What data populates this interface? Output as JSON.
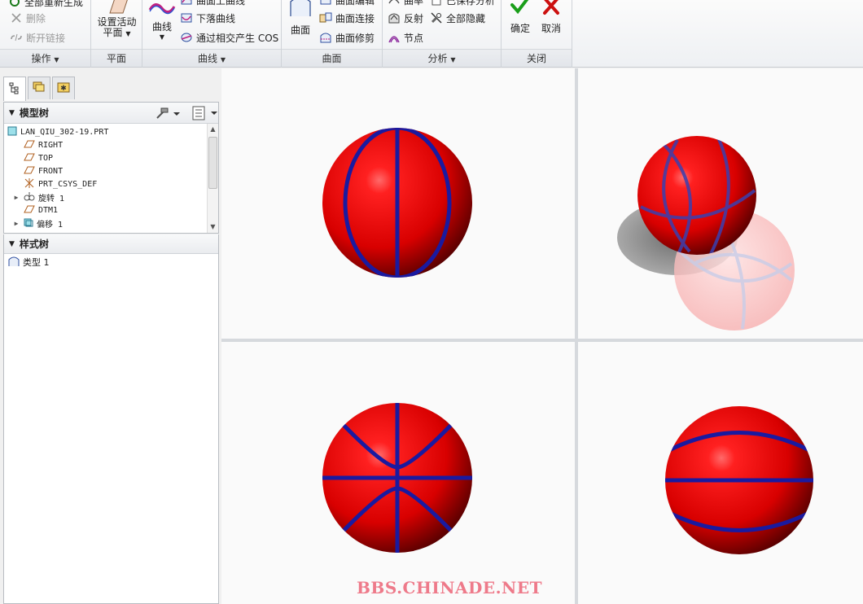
{
  "ribbon": {
    "operations": {
      "label": "操作",
      "items": {
        "regenerate_all": "全部重新生成",
        "delete": "删除",
        "break_link": "断开链接"
      }
    },
    "plane": {
      "label": "平面",
      "set_active_line1": "设置活动",
      "set_active_line2": "平面"
    },
    "curves": {
      "label": "曲线",
      "curve_button": "曲线",
      "items": {
        "curve_on_surface": "曲面上曲线",
        "drop_curve": "下落曲线",
        "intersect_cos": "通过相交产生 COS"
      }
    },
    "surfaces": {
      "label": "曲面",
      "surface_button": "曲面",
      "items": {
        "surface_join_top": "曲面编辑",
        "surface_connect": "曲面连接",
        "surface_trim": "曲面修剪"
      }
    },
    "analysis": {
      "label": "分析",
      "items": {
        "curvature": "曲率",
        "reflection": "反射",
        "node": "节点",
        "saved_analysis": "已保存分析",
        "hide_all": "全部隐藏"
      }
    },
    "close": {
      "label": "关闭",
      "ok": "确定",
      "cancel": "取消"
    }
  },
  "model_tree": {
    "title": "模型树",
    "rows": [
      {
        "label": "LAN_QIU_302-19.PRT",
        "icon": "part-icon"
      },
      {
        "label": "RIGHT",
        "icon": "datum-plane-icon"
      },
      {
        "label": "TOP",
        "icon": "datum-plane-icon"
      },
      {
        "label": "FRONT",
        "icon": "datum-plane-icon"
      },
      {
        "label": "PRT_CSYS_DEF",
        "icon": "csys-icon"
      },
      {
        "label": "旋转 1",
        "icon": "revolve-icon"
      },
      {
        "label": "DTM1",
        "icon": "datum-plane-icon"
      },
      {
        "label": "偏移 1",
        "icon": "offset-icon"
      }
    ]
  },
  "style_tree": {
    "title": "样式树",
    "rows": [
      {
        "label": "类型 1",
        "icon": "style-type-icon"
      }
    ]
  },
  "watermark": "BBS.CHINADE.NET",
  "colors": {
    "ball_red": "#e00000",
    "seam_blue": "#1a1aa0",
    "accept_green": "#1a9e1a",
    "cancel_red": "#cc1010"
  }
}
